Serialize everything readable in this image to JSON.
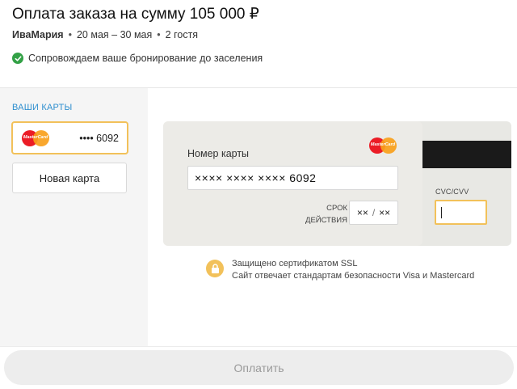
{
  "header": {
    "title": "Оплата заказа на сумму 105 000 ₽",
    "host": "ИваМария",
    "separator": "•",
    "dates": "20 мая – 30 мая",
    "guests": "2 гостя",
    "notice": "Сопровождаем ваше бронирование до заселения",
    "notice_icon": "check-circle-icon",
    "notice_icon_color": "#33a146"
  },
  "sidebar": {
    "title": "ВАШИ КАРТЫ",
    "saved_card": {
      "brand": "MasterCard",
      "masked_number": "•••• 6092",
      "selected": true
    },
    "new_card_label": "Новая карта"
  },
  "card_form": {
    "brand": "MasterCard",
    "number_label": "Номер карты",
    "number_value": "×××× ×××× ×××× 6092",
    "expiry_label_line1": "СРОК",
    "expiry_label_line2": "ДЕЙСТВИЯ",
    "expiry_month": "××",
    "expiry_separator": "/",
    "expiry_year": "××",
    "cvc_label": "CVC/CVV",
    "cvc_value": ""
  },
  "security": {
    "icon": "lock-icon",
    "line1": "Защищено сертификатом SSL",
    "line2": "Сайт отвечает стандартам безопасности Visa и Mastercard"
  },
  "footer": {
    "pay_label": "Оплатить",
    "pay_enabled": false
  },
  "colors": {
    "accent_yellow": "#f2c15a",
    "link_blue": "#2f8fcf",
    "success_green": "#33a146"
  }
}
